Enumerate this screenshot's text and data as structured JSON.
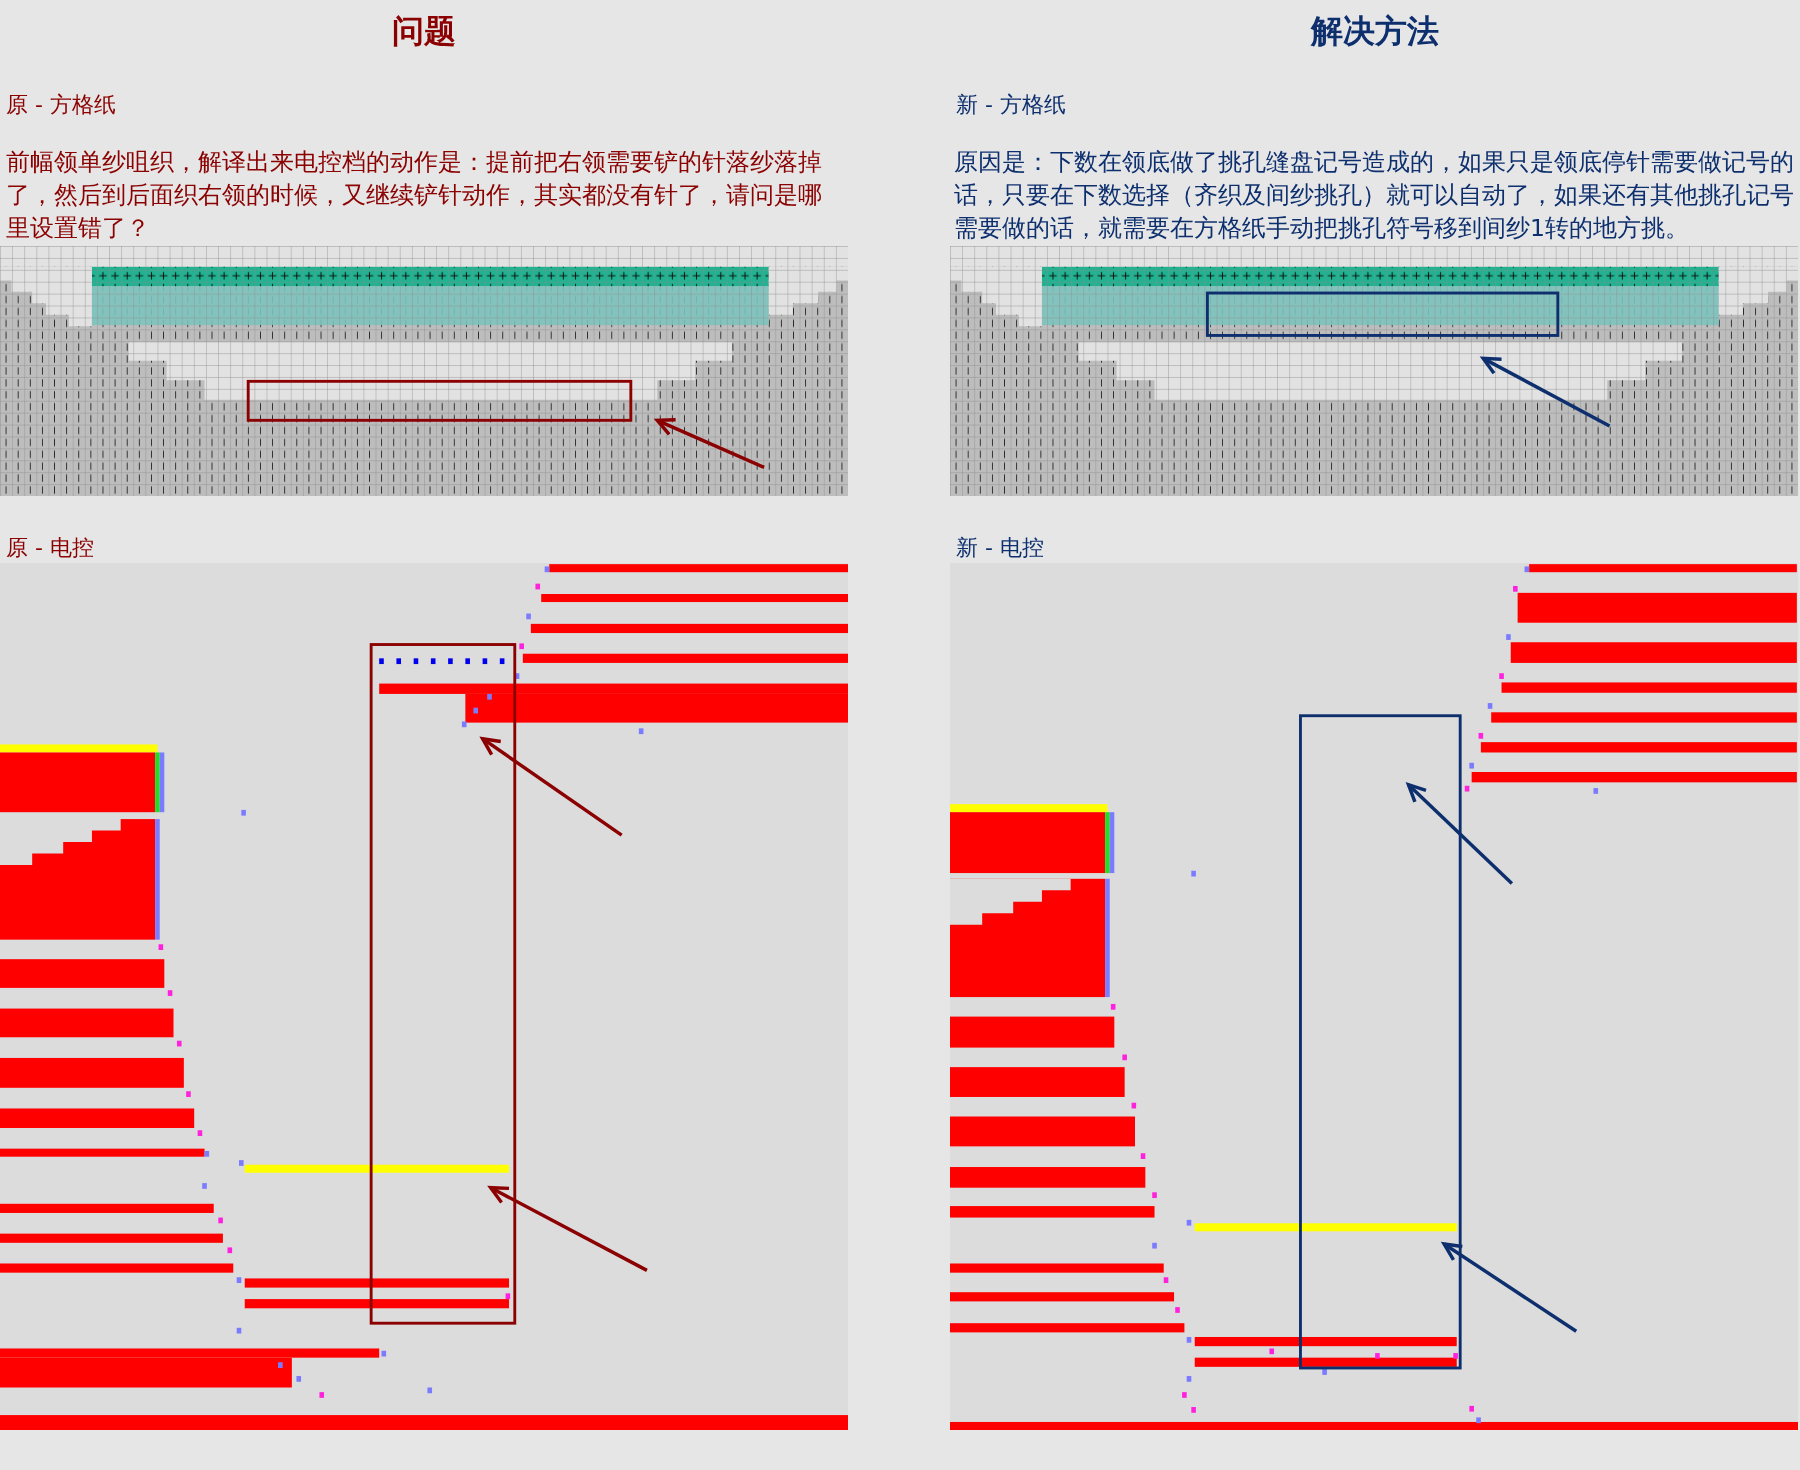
{
  "columns": [
    {
      "kind": "problem",
      "color": "#8b0000",
      "heading": "问题",
      "chart_caption": "原 - 方格纸",
      "description": "前幅领单纱咀织，解译出来电控档的动作是：提前把右领需要铲的针落纱落掉了，然后到后面织右领的时候，又继续铲针动作，其实都没有针了，请问是哪里设置错了？",
      "control_caption": "原 - 电控"
    },
    {
      "kind": "solution",
      "color": "#0d2f6e",
      "heading": "解决方法",
      "chart_caption": "新 - 方格纸",
      "description": "原因是：下数在领底做了挑孔缝盘记号造成的，如果只是领底停针需要做记号的话，只要在下数选择（齐织及间纱挑孔）就可以自动了，如果还有其他挑孔记号需要做的话，就需要在方格纸手动把挑孔符号移到间纱1转的地方挑。",
      "control_caption": "新 - 电控"
    }
  ]
}
